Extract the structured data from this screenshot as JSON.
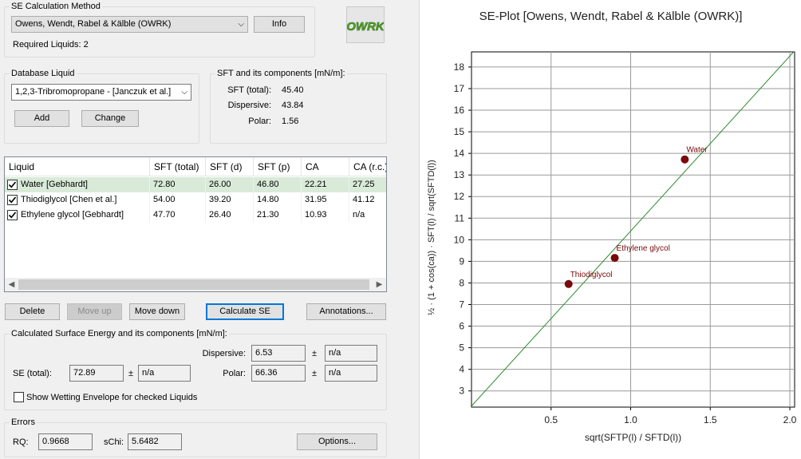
{
  "se_method": {
    "title": "SE Calculation Method",
    "selected": "Owens, Wendt, Rabel & Kälble (OWRK)",
    "info_label": "Info",
    "required_liquids": "Required Liquids: 2",
    "logo_text": "OWRK"
  },
  "database": {
    "title": "Database Liquid",
    "selected": "1,2,3-Tribromopropane - [Janczuk et al.]",
    "add_label": "Add",
    "change_label": "Change"
  },
  "sft": {
    "title": "SFT and its components [mN/m]:",
    "total_label": "SFT (total):",
    "total_value": "45.40",
    "disp_label": "Dispersive:",
    "disp_value": "43.84",
    "polar_label": "Polar:",
    "polar_value": "1.56"
  },
  "table": {
    "columns": [
      "Liquid",
      "SFT (total)",
      "SFT (d)",
      "SFT (p)",
      "CA",
      "CA (r.c.)"
    ],
    "rows": [
      {
        "liquid": "Water [Gebhardt]",
        "total": "72.80",
        "d": "26.00",
        "p": "46.80",
        "ca": "22.21",
        "carc": "27.25",
        "checked": true,
        "selected": true
      },
      {
        "liquid": "Thiodiglycol [Chen et al.]",
        "total": "54.00",
        "d": "39.20",
        "p": "14.80",
        "ca": "31.95",
        "carc": "41.12",
        "checked": true,
        "selected": false
      },
      {
        "liquid": "Ethylene glycol [Gebhardt]",
        "total": "47.70",
        "d": "26.40",
        "p": "21.30",
        "ca": "10.93",
        "carc": "n/a",
        "checked": true,
        "selected": false
      }
    ]
  },
  "actions": {
    "delete_label": "Delete",
    "move_up_label": "Move up",
    "move_down_label": "Move down",
    "calculate_label": "Calculate SE",
    "annotations_label": "Annotations..."
  },
  "results": {
    "title": "Calculated Surface Energy and its components [mN/m]:",
    "se_label": "SE (total):",
    "se_value": "72.89",
    "se_err": "n/a",
    "disp_label": "Dispersive:",
    "disp_value": "6.53",
    "disp_err": "n/a",
    "polar_label": "Polar:",
    "polar_value": "66.36",
    "polar_err": "n/a",
    "pm": "±",
    "wetting_label": "Show Wetting Envelope for checked Liquids"
  },
  "errors": {
    "title": "Errors",
    "rq_label": "RQ:",
    "rq_value": "0.9668",
    "schi_label": "sChi:",
    "schi_value": "5.6482",
    "options_label": "Options..."
  },
  "chart_data": {
    "type": "scatter",
    "title": "SE-Plot [Owens, Wendt, Rabel & Kälble (OWRK)]",
    "xlabel": "sqrt(SFTP(l) / SFTD(l))",
    "ylabel": "½ · (1 + cos(ca)) · SFT(l) / sqrt(SFTD(l))",
    "xlim": [
      0.0,
      2.03
    ],
    "ylim": [
      2.25,
      18.7
    ],
    "xticks": [
      0.5,
      1.0,
      1.5,
      2.0
    ],
    "xtick_labels": [
      "0.5",
      "1.0",
      "1.5",
      "2.0"
    ],
    "yticks": [
      3,
      4,
      5,
      6,
      7,
      8,
      9,
      10,
      11,
      12,
      13,
      14,
      15,
      16,
      17,
      18
    ],
    "grid": true,
    "points": [
      {
        "name": "Water",
        "x": 1.34,
        "y": 13.72
      },
      {
        "name": "Ethylene glycol",
        "x": 0.9,
        "y": 9.16
      },
      {
        "name": "Thiodiglycol",
        "x": 0.61,
        "y": 7.95
      }
    ],
    "fit_line": {
      "x": [
        0.0,
        2.03
      ],
      "y": [
        2.3,
        18.75
      ]
    },
    "point_color": "#7a0a0a",
    "line_color": "#2e8b2e"
  }
}
